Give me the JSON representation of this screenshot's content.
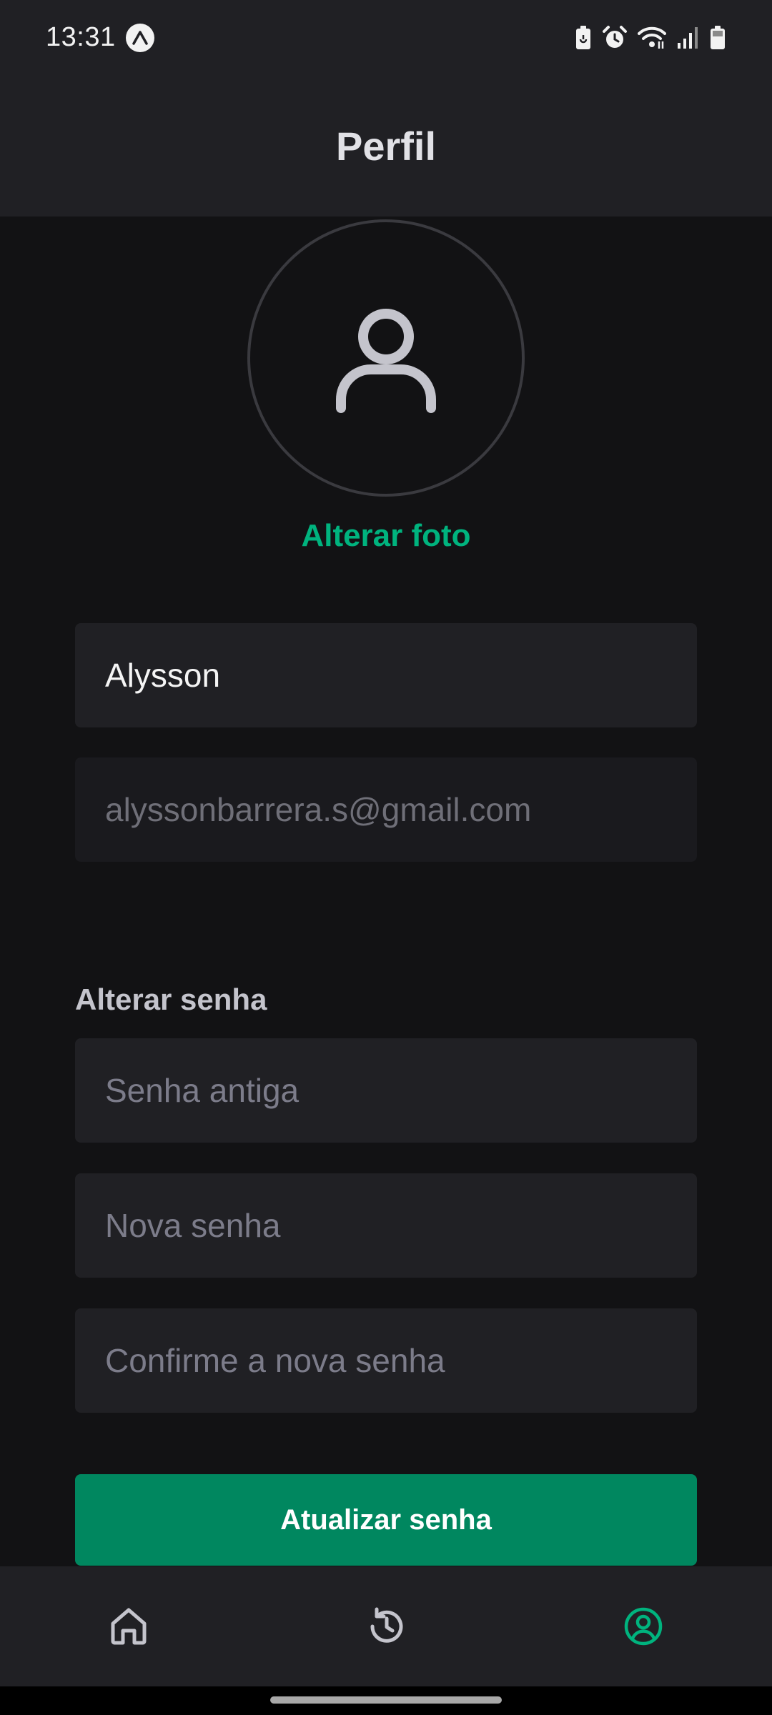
{
  "status_bar": {
    "time": "13:31",
    "icons": [
      "app-notification-icon",
      "battery-saver-icon",
      "alarm-icon",
      "wifi-icon",
      "signal-icon",
      "battery-icon"
    ]
  },
  "header": {
    "title": "Perfil"
  },
  "profile": {
    "avatar_icon": "user-icon",
    "change_photo_label": "Alterar foto",
    "name_value": "Alysson",
    "email_value": "alyssonbarrera.s@gmail.com"
  },
  "password_section": {
    "title": "Alterar senha",
    "old_password_placeholder": "Senha antiga",
    "new_password_placeholder": "Nova senha",
    "confirm_password_placeholder": "Confirme a nova senha",
    "submit_label": "Atualizar senha"
  },
  "tabbar": {
    "items": [
      {
        "icon": "home-icon",
        "active": false
      },
      {
        "icon": "history-icon",
        "active": false
      },
      {
        "icon": "profile-icon",
        "active": true
      }
    ]
  },
  "colors": {
    "accent": "#00b37e",
    "button": "#00875f",
    "background": "#121214",
    "surface": "#202024",
    "inactive_icon": "#c4c4cc"
  }
}
